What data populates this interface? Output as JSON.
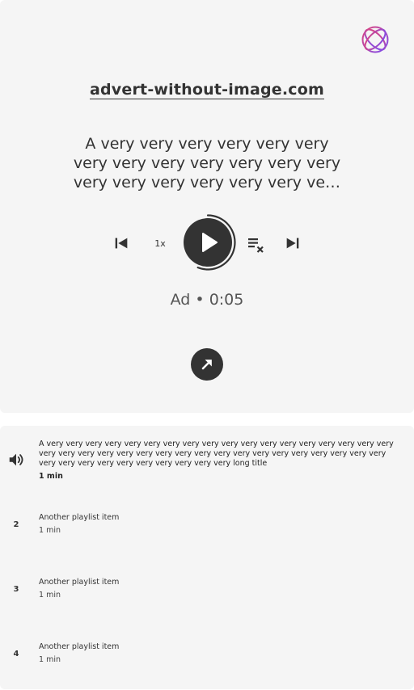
{
  "player": {
    "logo_icon": "orbit-logo-icon",
    "ad_link": "advert-without-image.com",
    "ad_title": "A very very very very very very very very very very very very very very very very very very very very very very very very very very very very very very very very very very very very very very very very very very very very very very long title",
    "speed_label": "1x",
    "ad_label": "Ad",
    "separator": "•",
    "countdown": "0:05",
    "progress": 0.35,
    "icons": {
      "prev": "skip-previous-icon",
      "play": "play-icon",
      "queue": "playlist-remove-icon",
      "next": "skip-next-icon",
      "open": "open-in-new-icon"
    },
    "colors": {
      "background": "#f5f5f5",
      "dark": "#333333",
      "logo_gradient_start": "#e0457b",
      "logo_gradient_end": "#7b4cf0"
    }
  },
  "playlist": {
    "items": [
      {
        "index": "",
        "icon": "speaker-icon",
        "title": "A very very very very very very very very very very very very very very very very very very very very very very very very very very very very very very very very very very very very very very very very very very very very very very long title",
        "duration": "1 min",
        "active": true
      },
      {
        "index": "2",
        "title": "Another playlist item",
        "duration": "1 min",
        "active": false
      },
      {
        "index": "3",
        "title": "Another playlist item",
        "duration": "1 min",
        "active": false
      },
      {
        "index": "4",
        "title": "Another playlist item",
        "duration": "1 min",
        "active": false
      }
    ]
  }
}
